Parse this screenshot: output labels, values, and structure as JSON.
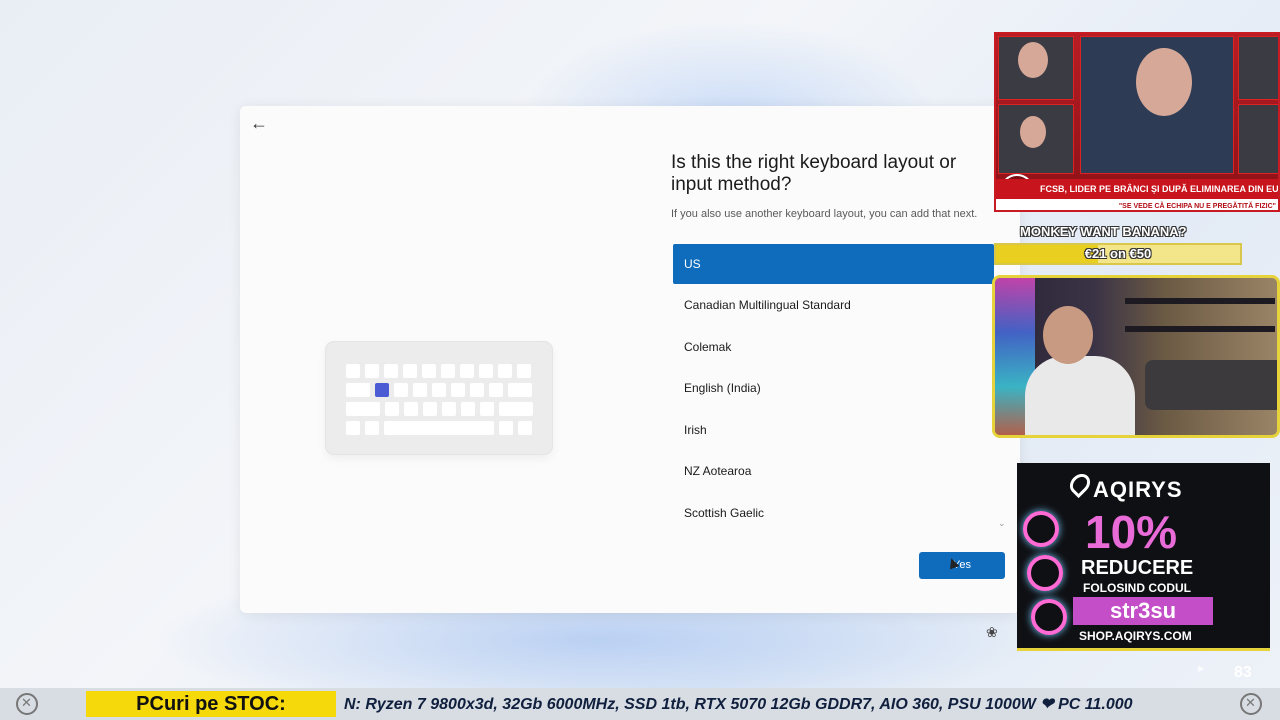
{
  "oobe": {
    "title": "Is this the right keyboard layout or input method?",
    "subtitle": "If you also use another keyboard layout, you can add that next.",
    "layouts": [
      {
        "label": "US",
        "selected": true
      },
      {
        "label": "Canadian Multilingual Standard",
        "selected": false
      },
      {
        "label": "Colemak",
        "selected": false
      },
      {
        "label": "English (India)",
        "selected": false
      },
      {
        "label": "Irish",
        "selected": false
      },
      {
        "label": "NZ Aotearoa",
        "selected": false
      },
      {
        "label": "Scottish Gaelic",
        "selected": false
      }
    ],
    "yes_label": "Yes",
    "accent_color": "#0f6cbd",
    "back_icon": "arrow-left-icon",
    "accessibility_icon": "accessibility-icon"
  },
  "overlays": {
    "news": {
      "headline": "FCSB, LIDER PE BRÂNCI ȘI DUPĂ ELIMINAREA DIN EUR",
      "quote": "\"SE VEDE CĂ ECHIPA NU E PREGĂTITĂ FIZIC\""
    },
    "goal": {
      "title": "MONKEY WANT BANANA?",
      "progress_text": "€21 on €50",
      "current": 21,
      "target": 50
    },
    "ad": {
      "brand": "AQIRYS",
      "discount": "10%",
      "line1": "REDUCERE",
      "line2": "FOLOSIND CODUL",
      "code": "str3su",
      "url": "SHOP.AQIRYS.COM"
    },
    "viewer_count": "83"
  },
  "ticker": {
    "label": "PCuri pe STOC:",
    "text": "N: Ryzen 7 9800x3d, 32Gb 6000MHz, SSD 1tb, RTX 5070 12Gb GDDR7, AIO 360, PSU 1000W ❤ PC 11.000"
  }
}
